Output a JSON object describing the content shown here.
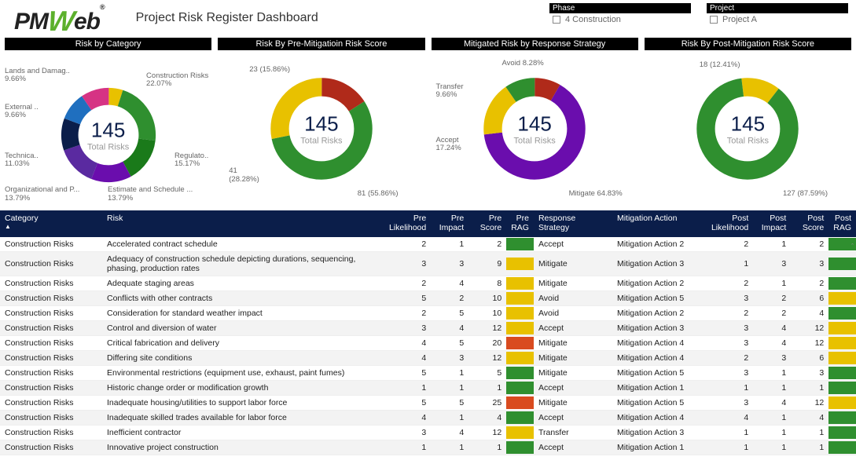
{
  "header": {
    "logo_pm": "PM",
    "logo_w": "W",
    "logo_eb": "eb",
    "logo_reg": "®",
    "title": "Project Risk Register Dashboard"
  },
  "filters": {
    "phase": {
      "label": "Phase",
      "value": "4 Construction"
    },
    "project": {
      "label": "Project",
      "value": "Project A"
    }
  },
  "center": {
    "value": "145",
    "sub": "Total Risks"
  },
  "chart_titles": {
    "cat": "Risk by Category",
    "pre": "Risk By Pre-Mitigatioin Risk Score",
    "strat": "Mitigated Risk by Response Strategy",
    "post": "Risk By Post-Mitigation Risk Score"
  },
  "chart_data": [
    {
      "type": "pie",
      "title": "Risk by Category",
      "series": [
        {
          "name": "Construction Risks",
          "value": 22.07,
          "color": "#2f8f2f"
        },
        {
          "name": "Regulato..",
          "value": 15.17,
          "color": "#1a7a1a"
        },
        {
          "name": "Estimate and Schedule ...",
          "value": 13.79,
          "color": "#6a0dad"
        },
        {
          "name": "Organizational and P...",
          "value": 13.79,
          "color": "#5a2aa0"
        },
        {
          "name": "Technica..",
          "value": 11.03,
          "color": "#0b1e4a"
        },
        {
          "name": "External ..",
          "value": 9.66,
          "color": "#1f6fbf"
        },
        {
          "name": "Lands and Damag..",
          "value": 9.66,
          "color": "#d63384"
        },
        {
          "name": "(other)",
          "value": 4.83,
          "color": "#e8c100"
        }
      ],
      "labels": {
        "construction": "Construction Risks\n22.07%",
        "regulato": "Regulato..\n15.17%",
        "estimate": "Estimate and Schedule ...\n13.79%",
        "organizational": "Organizational and P...\n13.79%",
        "technica": "Technica..\n11.03%",
        "external": "External ..\n9.66%",
        "lands": "Lands and Damag..\n9.66%"
      }
    },
    {
      "type": "pie",
      "title": "Risk By Pre-Mitigation Risk Score",
      "series": [
        {
          "name": "81 (55.86%)",
          "value": 55.86,
          "color": "#2f8f2f"
        },
        {
          "name": "41 (28.28%)",
          "value": 28.28,
          "color": "#e8c100"
        },
        {
          "name": "23 (15.86%)",
          "value": 15.86,
          "color": "#b02a1a"
        }
      ],
      "labels": {
        "a": "81 (55.86%)",
        "b": "41\n(28.28%)",
        "c": "23 (15.86%)"
      }
    },
    {
      "type": "pie",
      "title": "Mitigated Risk by Response Strategy",
      "series": [
        {
          "name": "Mitigate",
          "value": 64.83,
          "color": "#6a0dad"
        },
        {
          "name": "Accept",
          "value": 17.24,
          "color": "#e8c100"
        },
        {
          "name": "Transfer",
          "value": 9.66,
          "color": "#2f8f2f"
        },
        {
          "name": "Avoid",
          "value": 8.28,
          "color": "#b02a1a"
        }
      ],
      "labels": {
        "mitigate": "Mitigate 64.83%",
        "accept": "Accept\n17.24%",
        "transfer": "Transfer\n9.66%",
        "avoid": "Avoid 8.28%"
      }
    },
    {
      "type": "pie",
      "title": "Risk By Post-Mitigation Risk Score",
      "series": [
        {
          "name": "127 (87.59%)",
          "value": 87.59,
          "color": "#2f8f2f"
        },
        {
          "name": "18 (12.41%)",
          "value": 12.41,
          "color": "#e8c100"
        }
      ],
      "labels": {
        "a": "127 (87.59%)",
        "b": "18 (12.41%)"
      }
    }
  ],
  "table": {
    "headers": {
      "category": "Category",
      "risk": "Risk",
      "pre_like": "Pre Likelihood",
      "pre_imp": "Pre Impact",
      "pre_score": "Pre Score",
      "pre_rag": "Pre RAG",
      "strategy": "Response Strategy",
      "action": "Mitigation Action",
      "post_like": "Post Likelihood",
      "post_imp": "Post Impact",
      "post_score": "Post Score",
      "post_rag": "Post RAG"
    },
    "rows": [
      {
        "category": "Construction Risks",
        "risk": "Accelerated contract schedule",
        "pl": 2,
        "pi": 1,
        "ps": 2,
        "prag": "green",
        "strat": "Accept",
        "action": "Mitigation Action 2",
        "ql": 2,
        "qi": 1,
        "qs": 2,
        "qrag": "green"
      },
      {
        "category": "Construction Risks",
        "risk": "Adequacy of construction schedule depicting durations, sequencing, phasing, production rates",
        "pl": 3,
        "pi": 3,
        "ps": 9,
        "prag": "yellow",
        "strat": "Mitigate",
        "action": "Mitigation Action 3",
        "ql": 1,
        "qi": 3,
        "qs": 3,
        "qrag": "green"
      },
      {
        "category": "Construction Risks",
        "risk": "Adequate staging areas",
        "pl": 2,
        "pi": 4,
        "ps": 8,
        "prag": "yellow",
        "strat": "Mitigate",
        "action": "Mitigation Action 2",
        "ql": 2,
        "qi": 1,
        "qs": 2,
        "qrag": "green"
      },
      {
        "category": "Construction Risks",
        "risk": "Conflicts with other contracts",
        "pl": 5,
        "pi": 2,
        "ps": 10,
        "prag": "yellow",
        "strat": "Avoid",
        "action": "Mitigation Action 5",
        "ql": 3,
        "qi": 2,
        "qs": 6,
        "qrag": "yellow"
      },
      {
        "category": "Construction Risks",
        "risk": "Consideration for standard weather impact",
        "pl": 2,
        "pi": 5,
        "ps": 10,
        "prag": "yellow",
        "strat": "Avoid",
        "action": "Mitigation Action 2",
        "ql": 2,
        "qi": 2,
        "qs": 4,
        "qrag": "green"
      },
      {
        "category": "Construction Risks",
        "risk": "Control and diversion of water",
        "pl": 3,
        "pi": 4,
        "ps": 12,
        "prag": "yellow",
        "strat": "Accept",
        "action": "Mitigation Action 3",
        "ql": 3,
        "qi": 4,
        "qs": 12,
        "qrag": "yellow"
      },
      {
        "category": "Construction Risks",
        "risk": "Critical fabrication and delivery",
        "pl": 4,
        "pi": 5,
        "ps": 20,
        "prag": "red",
        "strat": "Mitigate",
        "action": "Mitigation Action 4",
        "ql": 3,
        "qi": 4,
        "qs": 12,
        "qrag": "yellow"
      },
      {
        "category": "Construction Risks",
        "risk": "Differing site conditions",
        "pl": 4,
        "pi": 3,
        "ps": 12,
        "prag": "yellow",
        "strat": "Mitigate",
        "action": "Mitigation Action 4",
        "ql": 2,
        "qi": 3,
        "qs": 6,
        "qrag": "yellow"
      },
      {
        "category": "Construction Risks",
        "risk": "Environmental restrictions (equipment use, exhaust, paint fumes)",
        "pl": 5,
        "pi": 1,
        "ps": 5,
        "prag": "green",
        "strat": "Mitigate",
        "action": "Mitigation Action 5",
        "ql": 3,
        "qi": 1,
        "qs": 3,
        "qrag": "green"
      },
      {
        "category": "Construction Risks",
        "risk": "Historic change order or modification growth",
        "pl": 1,
        "pi": 1,
        "ps": 1,
        "prag": "green",
        "strat": "Accept",
        "action": "Mitigation Action 1",
        "ql": 1,
        "qi": 1,
        "qs": 1,
        "qrag": "green"
      },
      {
        "category": "Construction Risks",
        "risk": "Inadequate housing/utilities to support labor force",
        "pl": 5,
        "pi": 5,
        "ps": 25,
        "prag": "red",
        "strat": "Mitigate",
        "action": "Mitigation Action 5",
        "ql": 3,
        "qi": 4,
        "qs": 12,
        "qrag": "yellow"
      },
      {
        "category": "Construction Risks",
        "risk": "Inadequate skilled trades available for labor force",
        "pl": 4,
        "pi": 1,
        "ps": 4,
        "prag": "green",
        "strat": "Accept",
        "action": "Mitigation Action 4",
        "ql": 4,
        "qi": 1,
        "qs": 4,
        "qrag": "green"
      },
      {
        "category": "Construction Risks",
        "risk": "Inefficient contractor",
        "pl": 3,
        "pi": 4,
        "ps": 12,
        "prag": "yellow",
        "strat": "Transfer",
        "action": "Mitigation Action 3",
        "ql": 1,
        "qi": 1,
        "qs": 1,
        "qrag": "green"
      },
      {
        "category": "Construction Risks",
        "risk": "Innovative project construction",
        "pl": 1,
        "pi": 1,
        "ps": 1,
        "prag": "green",
        "strat": "Accept",
        "action": "Mitigation Action 1",
        "ql": 1,
        "qi": 1,
        "qs": 1,
        "qrag": "green"
      }
    ]
  }
}
